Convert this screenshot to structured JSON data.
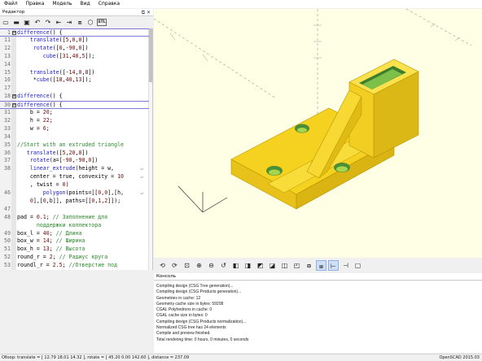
{
  "menu": [
    "Файл",
    "Правка",
    "Модель",
    "Вид",
    "Справка"
  ],
  "editor": {
    "title": "Редактор",
    "title_buttons": "⧉ ✕",
    "toolbar_icons": [
      "new-file-icon",
      "open-file-icon",
      "save-icon",
      "undo-icon",
      "redo-icon",
      "unindent-icon",
      "indent-icon",
      "preview-cube-icon",
      "render-cube-icon",
      "export-stl-icon"
    ],
    "toolbar_glyphs": [
      "▭",
      "▬",
      "▣",
      "↶",
      "↷",
      "⇤",
      "⇥",
      "⧈",
      "⬡",
      "STL"
    ],
    "lines": [
      {
        "n": "1",
        "fold": "⊟",
        "code": "difference() {",
        "box": true
      },
      {
        "n": "11",
        "fold": "",
        "code": "    translate([5,0,0])"
      },
      {
        "n": "12",
        "fold": "",
        "code": "     rotate([0,-90,0])"
      },
      {
        "n": "13",
        "fold": "",
        "code": "        cube([31,40,5]);"
      },
      {
        "n": "14",
        "fold": "",
        "code": ""
      },
      {
        "n": "15",
        "fold": "",
        "code": "    translate([-14,0,8])"
      },
      {
        "n": "16",
        "fold": "",
        "code": "     *cube([18,40,13]);"
      },
      {
        "n": "17",
        "fold": "",
        "code": ""
      },
      {
        "n": "18",
        "fold": "⊞",
        "code": "difference() {"
      },
      {
        "n": "30",
        "fold": "⊟",
        "code": "difference() {",
        "box": true
      },
      {
        "n": "31",
        "fold": "",
        "code": "    b = 20;"
      },
      {
        "n": "32",
        "fold": "",
        "code": "    h = 22;"
      },
      {
        "n": "33",
        "fold": "",
        "code": "    w = 6;"
      },
      {
        "n": "34",
        "fold": "",
        "code": ""
      },
      {
        "n": "35",
        "fold": "",
        "code": "//Start with an extruded triangle",
        "comment": true
      },
      {
        "n": "36",
        "fold": "",
        "code": "   translate([5,20,8])"
      },
      {
        "n": "37",
        "fold": "",
        "code": "    rotate(a=[-90,-90,0])"
      },
      {
        "n": "38",
        "fold": "",
        "code": "    linear_extrude(height = w,",
        "wrap": true
      },
      {
        "n": "",
        "fold": "",
        "code": "    center = true, convexity = 10",
        "wrap": true
      },
      {
        "n": "",
        "fold": "",
        "code": "    , twist = 0)"
      },
      {
        "n": "46",
        "fold": "",
        "code": "        polygon(points=[[0,0],[h,",
        "wrap": true
      },
      {
        "n": "",
        "fold": "",
        "code": "    0],[0,b]], paths=[[0,1,2]]);"
      },
      {
        "n": "47",
        "fold": "",
        "code": ""
      },
      {
        "n": "48",
        "fold": "",
        "code": "pad = 0.1; // Заполнение для",
        "comment_from": 11
      },
      {
        "n": "",
        "fold": "",
        "code": "      поддержки коллектора",
        "comment": true
      },
      {
        "n": "49",
        "fold": "",
        "code": "box_l = 40; // Длина",
        "comment_from": 12
      },
      {
        "n": "50",
        "fold": "",
        "code": "box_w = 14; // Ширина",
        "comment_from": 12
      },
      {
        "n": "51",
        "fold": "",
        "code": "box_h = 13; // Высота",
        "comment_from": 12
      },
      {
        "n": "52",
        "fold": "",
        "code": "round_r = 2; // Радиус круга",
        "comment_from": 13
      },
      {
        "n": "53",
        "fold": "",
        "code": "roundl_r = 2.5; //Отверстие под",
        "comment_from": 16
      },
      {
        "n": "",
        "fold": "",
        "code": "      саморез",
        "comment": true
      },
      {
        "n": "54",
        "fold": "",
        "code": "smooth = 200; // Количество",
        "comment_from": 14
      },
      {
        "n": "",
        "fold": "",
        "code": "      граней окружности цилиндра",
        "comment": true
      },
      {
        "n": "55",
        "fold": "⊞",
        "code": "difference() {",
        "box": true
      }
    ]
  },
  "viewport": {
    "background": "#ffffe5",
    "model_color": "#f9d72c"
  },
  "view_toolbar_icons": [
    "preview-icon",
    "render-icon",
    "view-all-icon",
    "zoom-in-icon",
    "zoom-out-icon",
    "reset-view-icon",
    "view-right-icon",
    "view-top-icon",
    "view-bottom-icon",
    "view-left-icon",
    "view-front-icon",
    "view-back-icon",
    "perspective-icon",
    "orthogonal-icon",
    "show-axes-icon",
    "show-scale-icon",
    "show-edges-icon"
  ],
  "view_toolbar_glyphs": [
    "⟲",
    "⟳",
    "⊡",
    "⊕",
    "⊖",
    "↺",
    "◧",
    "◨",
    "◩",
    "◪",
    "◫",
    "◰",
    "⧇",
    "⧆",
    "⊢",
    "⊣",
    "▢"
  ],
  "console": {
    "title": "Консоль",
    "lines": [
      "Compiling design (CSG Tree generation)...",
      "Compiling design (CSG Products generation)...",
      "Geometries in cache: 12",
      "Geometry cache size in bytes: 59208",
      "CGAL Polyhedrons in cache: 0",
      "CGAL cache size in bytes: 0",
      "Compiling design (CSG Products normalization)...",
      "Normalized CSG tree has 24 elements",
      "Compile and preview finished.",
      "Total rendering time: 0 hours, 0 minutes, 0 seconds"
    ]
  },
  "status": {
    "left": "Обзор: translate = [ 12.79 18.01 14.32 ], rotate = [ 45.20 0.00 142.60 ], distance = 237.09",
    "right": "OpenSCAD 2015.03"
  }
}
